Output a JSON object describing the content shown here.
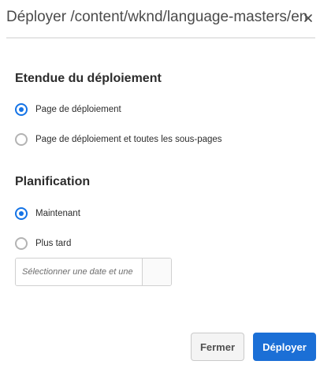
{
  "dialog": {
    "title": "Déployer /content/wknd/language-masters/en",
    "close_icon": "close-icon"
  },
  "scope": {
    "heading": "Etendue du déploiement",
    "options": [
      {
        "label": "Page de déploiement",
        "checked": true
      },
      {
        "label": "Page de déploiement et toutes les sous-pages",
        "checked": false
      }
    ]
  },
  "schedule": {
    "heading": "Planification",
    "options": [
      {
        "label": "Maintenant",
        "checked": true
      },
      {
        "label": "Plus tard",
        "checked": false
      }
    ],
    "date_placeholder": "Sélectionner une date et une heure",
    "date_value": ""
  },
  "buttons": {
    "close_label": "Fermer",
    "deploy_label": "Déployer"
  },
  "colors": {
    "accent": "#1473e6",
    "primary_button": "#1b6fd6"
  }
}
